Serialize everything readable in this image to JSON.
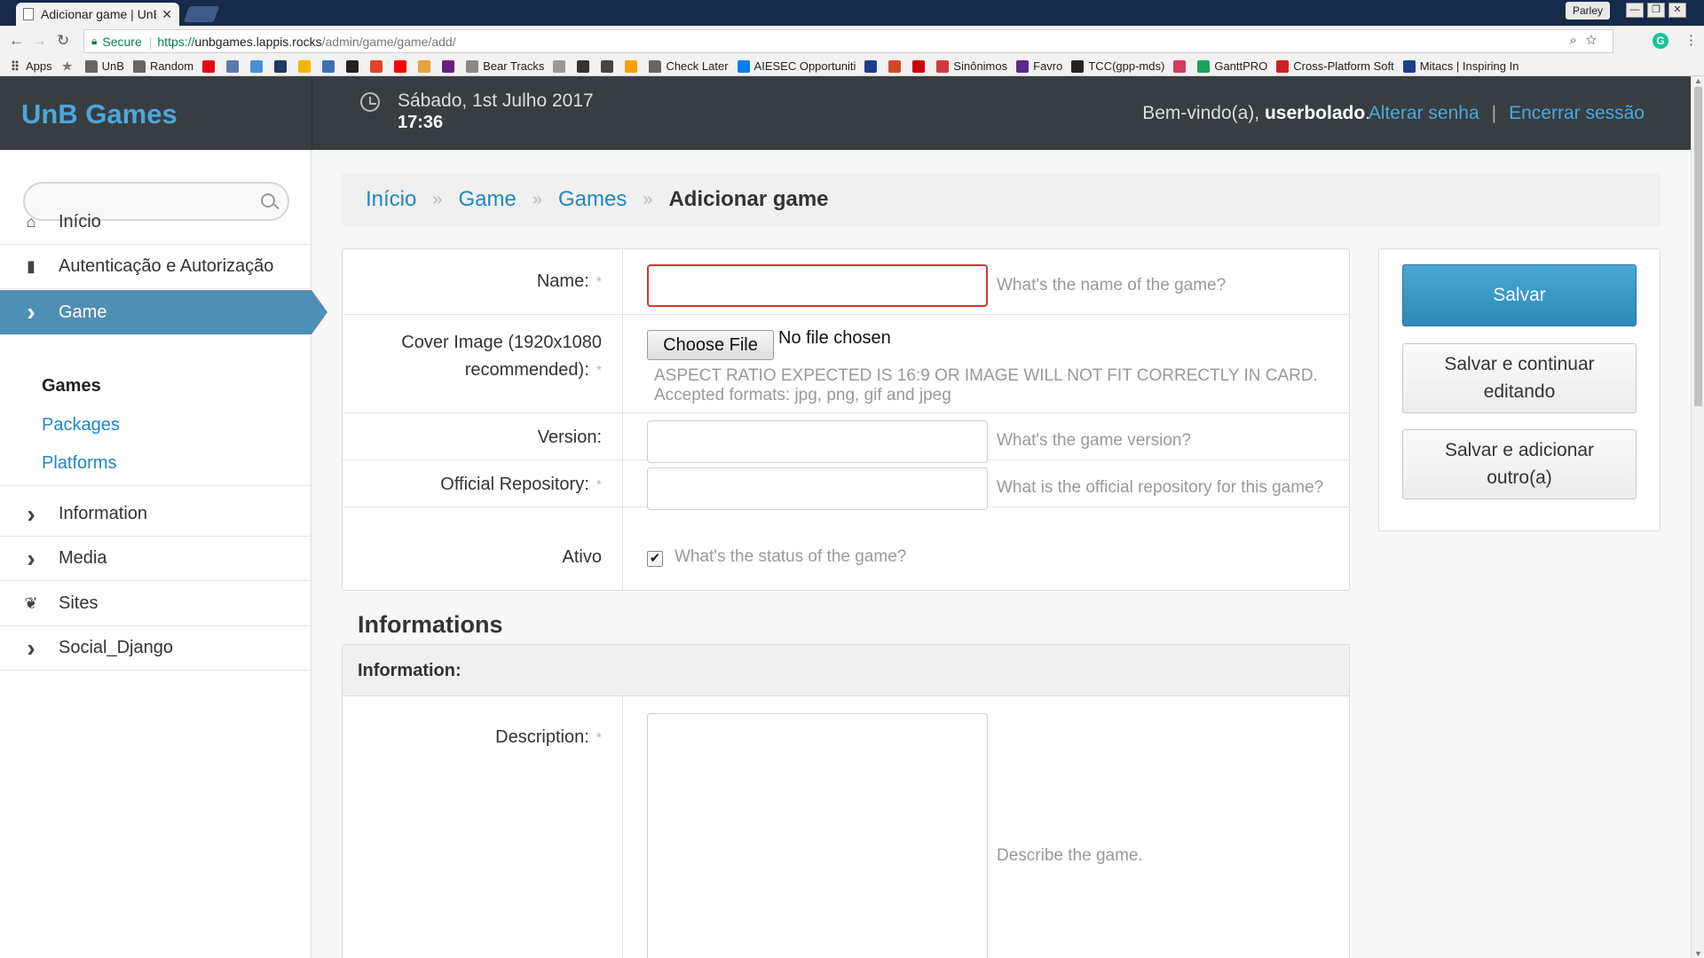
{
  "browser": {
    "tab_title": "Adicionar game | UnB",
    "tab_close": "✕",
    "profile": "Parley",
    "window_controls": [
      "—",
      "❐",
      "✕"
    ],
    "nav": {
      "back": "←",
      "forward": "→",
      "reload": "↻"
    },
    "secure_label": "Secure",
    "url_scheme": "https://",
    "url_host": "unbgames.lappis.rocks",
    "url_path": "/admin/game/game/add/",
    "omni_icons": "⌕☆",
    "menu_icon": "⋮",
    "bookmarks": [
      {
        "label": "Apps",
        "icon": "apps-icon",
        "color": "#444444"
      },
      {
        "label": "",
        "icon": "star-icon",
        "color": "#777777"
      },
      {
        "label": "UnB",
        "icon": "folder-icon",
        "color": "#666666"
      },
      {
        "label": "Random",
        "icon": "folder-icon",
        "color": "#666666"
      },
      {
        "label": "",
        "icon": "netflix-icon",
        "color": "#e50914"
      },
      {
        "label": "",
        "icon": "bookmark-icon",
        "color": "#5b7ba8"
      },
      {
        "label": "",
        "icon": "mail-icon",
        "color": "#4a8fd8"
      },
      {
        "label": "",
        "icon": "trello-icon",
        "color": "#1f3a5c"
      },
      {
        "label": "",
        "icon": "drive-icon",
        "color": "#f4b400"
      },
      {
        "label": "",
        "icon": "app-icon",
        "color": "#3d6fb6"
      },
      {
        "label": "",
        "icon": "github-icon",
        "color": "#222222"
      },
      {
        "label": "",
        "icon": "gitlab-icon",
        "color": "#e24329"
      },
      {
        "label": "",
        "icon": "youtube-icon",
        "color": "#ff0000"
      },
      {
        "label": "",
        "icon": "app-icon",
        "color": "#e8a33b"
      },
      {
        "label": "",
        "icon": "visual-studio-icon",
        "color": "#68217a"
      },
      {
        "label": "Bear Tracks",
        "icon": "page-icon",
        "color": "#888888"
      },
      {
        "label": "",
        "icon": "app-icon",
        "color": "#999999"
      },
      {
        "label": "",
        "icon": "app-icon",
        "color": "#333333"
      },
      {
        "label": "",
        "icon": "app-icon",
        "color": "#444444"
      },
      {
        "label": "",
        "icon": "app-icon",
        "color": "#f4a000"
      },
      {
        "label": "Check Later",
        "icon": "folder-icon",
        "color": "#666666"
      },
      {
        "label": "AIESEC Opportuniti",
        "icon": "aiesec-icon",
        "color": "#037ef3"
      },
      {
        "label": "",
        "icon": "app-icon",
        "color": "#1d3c8c"
      },
      {
        "label": "",
        "icon": "app-icon",
        "color": "#d04a2a"
      },
      {
        "label": "",
        "icon": "app-icon",
        "color": "#cc0000"
      },
      {
        "label": "Sinônimos",
        "icon": "sinonimos-icon",
        "color": "#d13b3b"
      },
      {
        "label": "Favro",
        "icon": "favro-icon",
        "color": "#5a2a8a"
      },
      {
        "label": "TCC(gpp-mds)",
        "icon": "github-icon",
        "color": "#222222"
      },
      {
        "label": "",
        "icon": "app-icon",
        "color": "#d63b5c"
      },
      {
        "label": "GanttPRO",
        "icon": "ganttpro-icon",
        "color": "#1aa35f"
      },
      {
        "label": "Cross-Platform Soft",
        "icon": "app-icon",
        "color": "#cc2222"
      },
      {
        "label": "Mitacs | Inspiring In",
        "icon": "mitacs-icon",
        "color": "#1b3f8b"
      }
    ]
  },
  "header": {
    "brand": "UnB Games",
    "date": "Sábado, 1st Julho 2017",
    "time": "17:36",
    "welcome_prefix": "Bem-vindo(a), ",
    "username": "userbolado",
    "welcome_suffix": ".",
    "change_password": "Alterar senha",
    "divider": "|",
    "logout": "Encerrar sessão"
  },
  "sidebar": {
    "search_placeholder": "",
    "items": [
      {
        "label": "Início",
        "icon": "home-icon",
        "glyph": "⌂"
      },
      {
        "label": "Autenticação e Autorização",
        "icon": "lock-icon",
        "glyph": "▮"
      },
      {
        "label": "Game",
        "icon": "chevron-right-icon",
        "glyph": "›"
      },
      {
        "label": "Information",
        "icon": "chevron-right-icon",
        "glyph": "›"
      },
      {
        "label": "Media",
        "icon": "chevron-right-icon",
        "glyph": "›"
      },
      {
        "label": "Sites",
        "icon": "leaf-icon",
        "glyph": "❦"
      },
      {
        "label": "Social_Django",
        "icon": "chevron-right-icon",
        "glyph": "›"
      }
    ],
    "subitems": [
      "Games",
      "Packages",
      "Platforms"
    ]
  },
  "breadcrumb": {
    "items": [
      "Início",
      "Game",
      "Games"
    ],
    "separator": "»",
    "current": "Adicionar game"
  },
  "form": {
    "required_mark": "*",
    "name_label": "Name:",
    "name_value": "",
    "name_help": "What's the name of the game?",
    "cover_label_line1": "Cover Image (1920x1080",
    "cover_label_line2": "recommended):",
    "file_button": "Choose File",
    "file_status": "No file chosen",
    "cover_help": "ASPECT RATIO EXPECTED IS 16:9 OR IMAGE WILL NOT FIT CORRECTLY IN CARD. Accepted formats: jpg, png, gif and jpeg",
    "version_label": "Version:",
    "version_value": "",
    "version_help": "What's the game version?",
    "repo_label": "Official Repository:",
    "repo_value": "",
    "repo_help": "What is the official repository for this game?",
    "active_label": "Ativo",
    "active_checked": true,
    "active_mark": "✔",
    "active_help": "What's the status of the game?"
  },
  "informations": {
    "section_title": "Informations",
    "fieldset_title": "Information:",
    "description_label": "Description:",
    "description_value": "",
    "description_help": "Describe the game."
  },
  "submit": {
    "save": "Salvar",
    "save_continue_line1": "Salvar e continuar",
    "save_continue_line2": "editando",
    "save_add_line1": "Salvar e adicionar",
    "save_add_line2": "outro(a)"
  },
  "colors": {
    "accent": "#1e88c7",
    "header_bg": "#383d41",
    "active_menu": "#4e8fb5",
    "error": "#dd3333"
  }
}
